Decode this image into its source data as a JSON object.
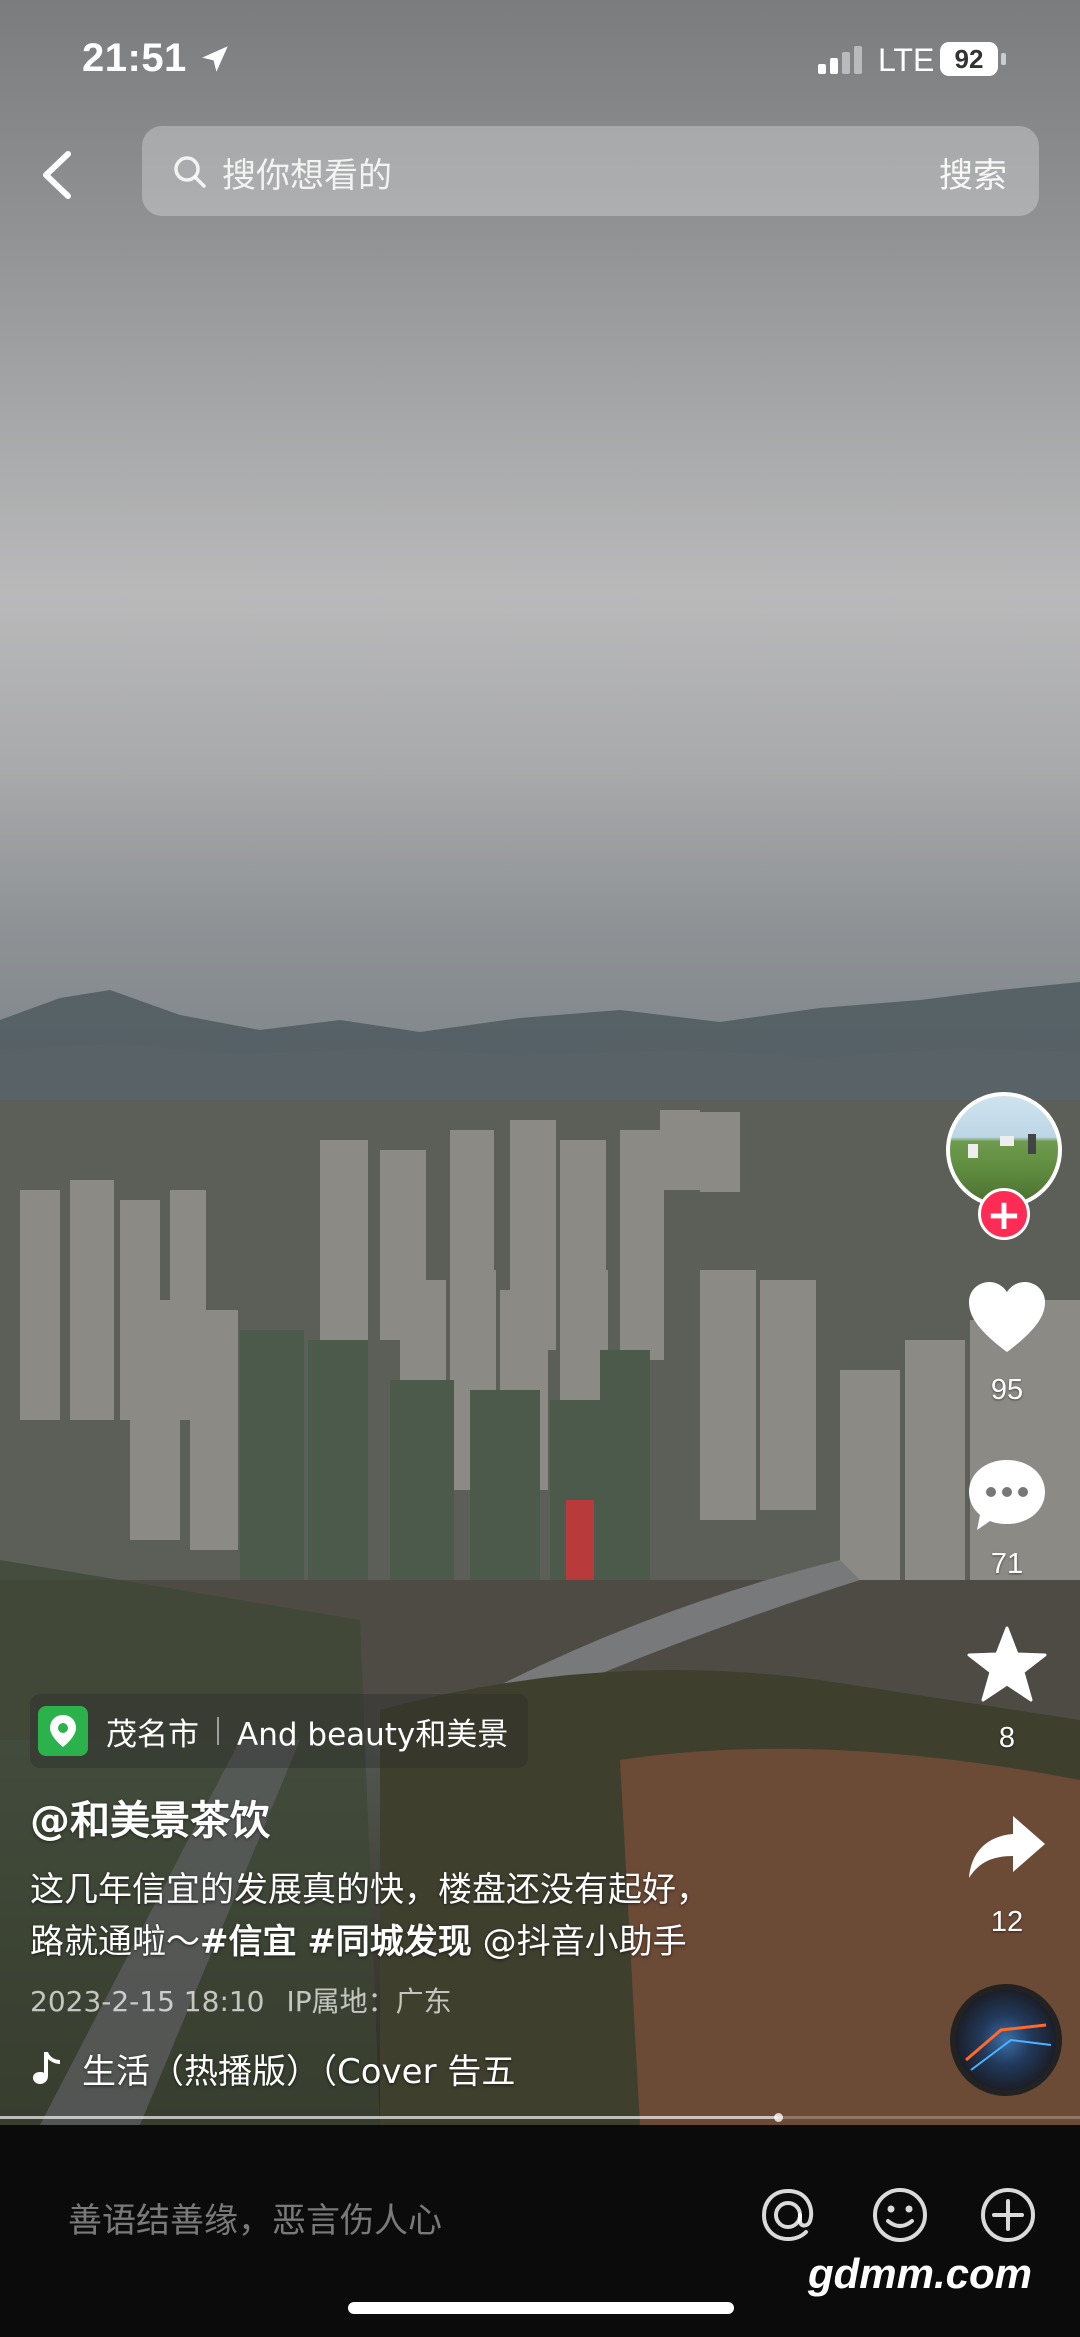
{
  "status_bar": {
    "time": "21:51",
    "network": "LTE",
    "battery": "92"
  },
  "search": {
    "placeholder": "搜你想看的",
    "button": "搜索"
  },
  "rail": {
    "likes": "95",
    "comments": "71",
    "favorites": "8",
    "shares": "12"
  },
  "poi": {
    "city": "茂名市",
    "shop": "And beauty和美景"
  },
  "author": "@和美景茶饮",
  "description": {
    "line1": "这几年信宜的发展真的快，楼盘还没有起好，",
    "line2_prefix": "路就通啦～",
    "tag1": "#信宜",
    "tag2": "#同城发现",
    "mention": "@抖音小助手"
  },
  "meta": {
    "date": "2023-2-15 18:10",
    "ip": "IP属地：广东"
  },
  "music": {
    "title": "生活（热播版）（Cover 告五"
  },
  "progress": 0.72,
  "comment_bar": {
    "placeholder": "善语结善缘，恶言伤人心"
  },
  "watermark": "gdmm.com",
  "colors": {
    "follow": "#fe2c55",
    "poi_green": "#2bb24c"
  },
  "icons": [
    "location-arrow-icon",
    "signal-icon",
    "back-icon",
    "search-icon",
    "plus-icon",
    "heart-icon",
    "comment-icon",
    "star-icon",
    "share-icon",
    "music-note-icon",
    "at-icon",
    "emoji-icon",
    "add-icon",
    "map-pin-icon"
  ]
}
